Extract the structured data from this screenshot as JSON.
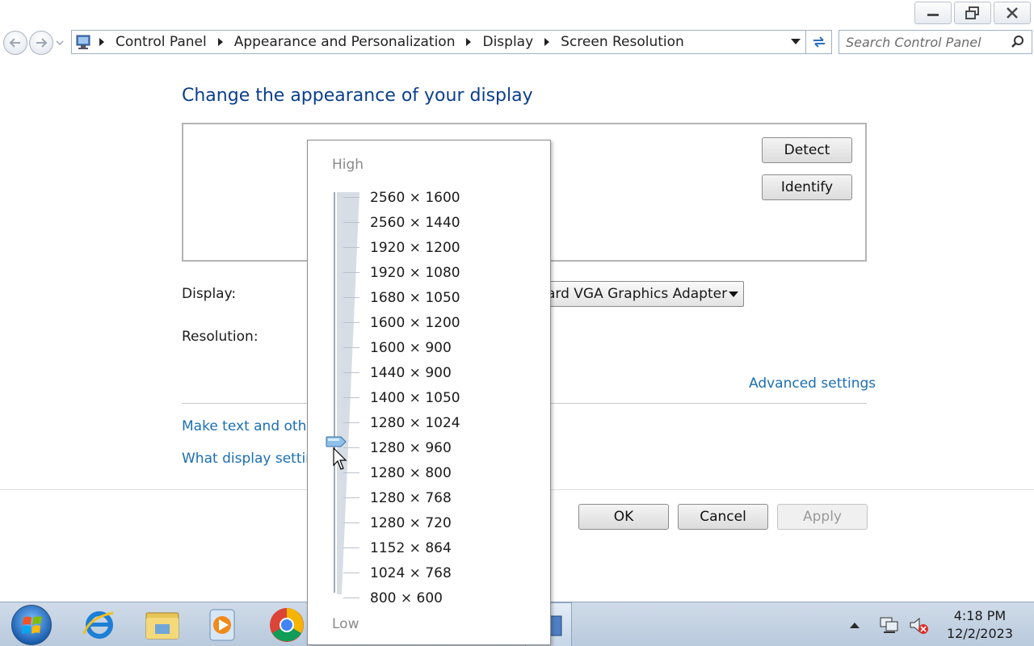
{
  "window": {
    "buttons": [
      "minimize",
      "restore",
      "close"
    ]
  },
  "address_bar": {
    "breadcrumbs": [
      "Control Panel",
      "Appearance and Personalization",
      "Display",
      "Screen Resolution"
    ]
  },
  "search": {
    "placeholder": "Search Control Panel"
  },
  "main": {
    "title": "Change the appearance of your display",
    "detect_label": "Detect",
    "identify_label": "Identify",
    "display_label": "Display:",
    "display_value": "ard VGA Graphics Adapter",
    "resolution_label": "Resolution:",
    "advanced_link": "Advanced settings",
    "link_text_size": "Make text and other",
    "link_what_settings": "What display setting"
  },
  "resolution_dropdown": {
    "high_label": "High",
    "low_label": "Low",
    "options": [
      "2560 × 1600",
      "2560 × 1440",
      "1920 × 1200",
      "1920 × 1080",
      "1680 × 1050",
      "1600 × 1200",
      "1600 × 900",
      "1440 × 900",
      "1400 × 1050",
      "1280 × 1024",
      "1280 × 960",
      "1280 × 800",
      "1280 × 768",
      "1280 × 720",
      "1152 × 864",
      "1024 × 768",
      "800 × 600"
    ],
    "selected": "1280 × 960"
  },
  "footer": {
    "ok_label": "OK",
    "cancel_label": "Cancel",
    "apply_label": "Apply"
  },
  "taskbar": {
    "clock_time": "4:18 PM",
    "clock_date": "12/2/2023",
    "pinned": [
      "internet-explorer-icon",
      "file-explorer-icon",
      "media-player-icon",
      "chrome-icon"
    ]
  }
}
